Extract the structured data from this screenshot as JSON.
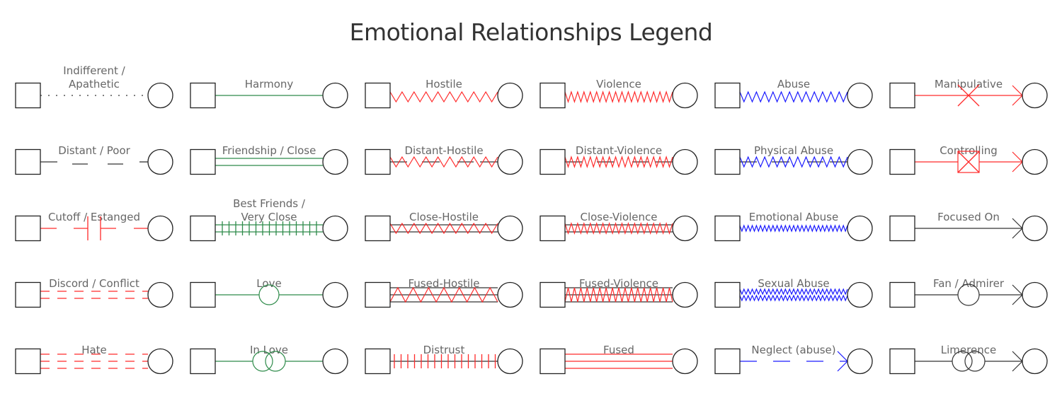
{
  "title": "Emotional Relationships Legend",
  "colors": {
    "red": "#ff2a2a",
    "green": "#2e8b4a",
    "blue": "#1a1aff",
    "black": "#333333",
    "label": "#666666"
  },
  "columns": [
    {
      "items": [
        {
          "label": [
            "Indifferent /",
            "Apathetic"
          ],
          "style": "dotted",
          "color": "black"
        },
        {
          "label": [
            "Distant / Poor"
          ],
          "style": "distant",
          "color": "black"
        },
        {
          "label": [
            "Cutoff / Estanged"
          ],
          "style": "cutoff",
          "color": "red"
        },
        {
          "label": [
            "Discord / Conflict"
          ],
          "style": "dashed2",
          "color": "red"
        },
        {
          "label": [
            "Hate"
          ],
          "style": "dashed3",
          "color": "red"
        }
      ]
    },
    {
      "items": [
        {
          "label": [
            "Harmony"
          ],
          "style": "solid",
          "color": "green"
        },
        {
          "label": [
            "Friendship / Close"
          ],
          "style": "double",
          "color": "green"
        },
        {
          "label": [
            "Best Friends /",
            "Very Close"
          ],
          "style": "ticked-double",
          "color": "green"
        },
        {
          "label": [
            "Love"
          ],
          "style": "love",
          "color": "green"
        },
        {
          "label": [
            "In Love"
          ],
          "style": "inlove",
          "color": "green"
        }
      ]
    },
    {
      "items": [
        {
          "label": [
            "Hostile"
          ],
          "style": "zig",
          "color": "red",
          "zigs": 9
        },
        {
          "label": [
            "Distant-Hostile"
          ],
          "style": "zig-distant",
          "color": "red",
          "zigs": 9
        },
        {
          "label": [
            "Close-Hostile"
          ],
          "style": "zig-close",
          "color": "red",
          "zigs": 9
        },
        {
          "label": [
            "Fused-Hostile"
          ],
          "style": "zig-fused",
          "color": "red",
          "zigs": 7
        },
        {
          "label": [
            "Distrust"
          ],
          "style": "distrust",
          "color": "red"
        }
      ]
    },
    {
      "items": [
        {
          "label": [
            "Violence"
          ],
          "style": "zig",
          "color": "red",
          "zigs": 17
        },
        {
          "label": [
            "Distant-Violence"
          ],
          "style": "zig-distant",
          "color": "red",
          "zigs": 17
        },
        {
          "label": [
            "Close-Violence"
          ],
          "style": "zig-close",
          "color": "red",
          "zigs": 17
        },
        {
          "label": [
            "Fused-Violence"
          ],
          "style": "zig-fused",
          "color": "red",
          "zigs": 17
        },
        {
          "label": [
            "Fused"
          ],
          "style": "triple",
          "color": "red"
        }
      ]
    },
    {
      "items": [
        {
          "label": [
            "Abuse"
          ],
          "style": "zig",
          "color": "blue",
          "zigs": 13
        },
        {
          "label": [
            "Physical Abuse"
          ],
          "style": "zig-distant",
          "color": "blue",
          "zigs": 13
        },
        {
          "label": [
            "Emotional Abuse"
          ],
          "style": "zig-small",
          "color": "blue",
          "zigs": 26
        },
        {
          "label": [
            "Sexual Abuse"
          ],
          "style": "zig-double-small",
          "color": "blue",
          "zigs": 26
        },
        {
          "label": [
            "Neglect (abuse)"
          ],
          "style": "neglect",
          "color": "blue"
        }
      ]
    },
    {
      "items": [
        {
          "label": [
            "Manipulative"
          ],
          "style": "manipulative",
          "color": "red"
        },
        {
          "label": [
            "Controlling"
          ],
          "style": "controlling",
          "color": "red"
        },
        {
          "label": [
            "Focused On"
          ],
          "style": "arrow",
          "color": "black"
        },
        {
          "label": [
            "Fan / Admirer"
          ],
          "style": "fan",
          "color": "black"
        },
        {
          "label": [
            "Limerence"
          ],
          "style": "limerence",
          "color": "black"
        }
      ]
    }
  ]
}
